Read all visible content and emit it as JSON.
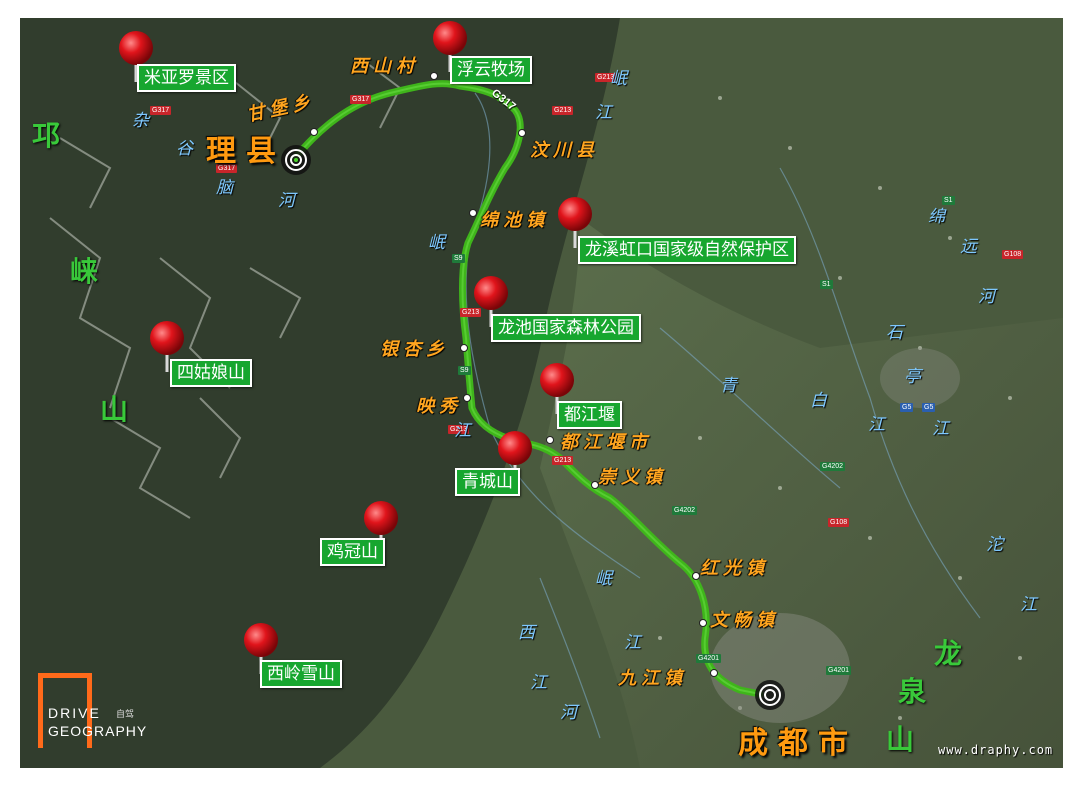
{
  "poi": [
    {
      "id": "miyaluo",
      "label": "米亚罗景区"
    },
    {
      "id": "fuyun",
      "label": "浮云牧场"
    },
    {
      "id": "longxi",
      "label": "龙溪虹口国家级自然保护区"
    },
    {
      "id": "longchi",
      "label": "龙池国家森林公园"
    },
    {
      "id": "siguniang",
      "label": "四姑娘山"
    },
    {
      "id": "dujiangyan",
      "label": "都江堰"
    },
    {
      "id": "qingcheng",
      "label": "青城山"
    },
    {
      "id": "jiguan",
      "label": "鸡冠山"
    },
    {
      "id": "xiling",
      "label": "西岭雪山"
    }
  ],
  "towns": {
    "xishancun": "西山村",
    "ganbao": "甘堡乡",
    "lixian": "理县",
    "wenchuan": "汶川县",
    "mianchi": "绵池镇",
    "yinxing": "银杏乡",
    "yingxiu": "映秀",
    "dujiangyan_city": "都江堰市",
    "chongyi": "崇义镇",
    "hongguang": "红光镇",
    "wenjiang": "文畅镇",
    "jiujiang": "九江镇",
    "chengdu": "成都市"
  },
  "rivers": {
    "zagunao": [
      "杂",
      "谷",
      "脑",
      "河"
    ],
    "minjiang_top": [
      "岷",
      "江"
    ],
    "minjiang_mid": [
      "岷",
      "江"
    ],
    "minjiang_low": [
      "岷",
      "江"
    ],
    "mianyuan": [
      "绵",
      "远",
      "河"
    ],
    "shiting": [
      "石",
      "亭",
      "江"
    ],
    "qingbai": [
      "青",
      "白",
      "江"
    ],
    "tuojiang": [
      "沱",
      "江"
    ],
    "xihe": [
      "西",
      "江",
      "河"
    ]
  },
  "mountains": {
    "qionglai": [
      "邛",
      "崃",
      "山"
    ],
    "longquan": [
      "龙",
      "泉",
      "山"
    ]
  },
  "road_shields": [
    "G317",
    "G317",
    "G317",
    "G213",
    "G213",
    "S9",
    "G213",
    "S9",
    "G213",
    "G213",
    "G4202",
    "G4202",
    "G108",
    "G5",
    "G5",
    "G4201",
    "G4201",
    "S1",
    "S1",
    "G108"
  ],
  "route_label": "G317",
  "logo": {
    "line1": "DRIVE",
    "line1_cn": "自驾",
    "line2": "GEOGRAPHY"
  },
  "watermark": "www.draphy.com",
  "colors": {
    "route": "#3fb51b",
    "label_bg": "#17a62f",
    "pin": "#e0141b",
    "town_text": "#ffa51f",
    "river_text": "#7ec8ff",
    "mountain_text": "#39c93a",
    "logo_orange": "#ff6a1a"
  }
}
